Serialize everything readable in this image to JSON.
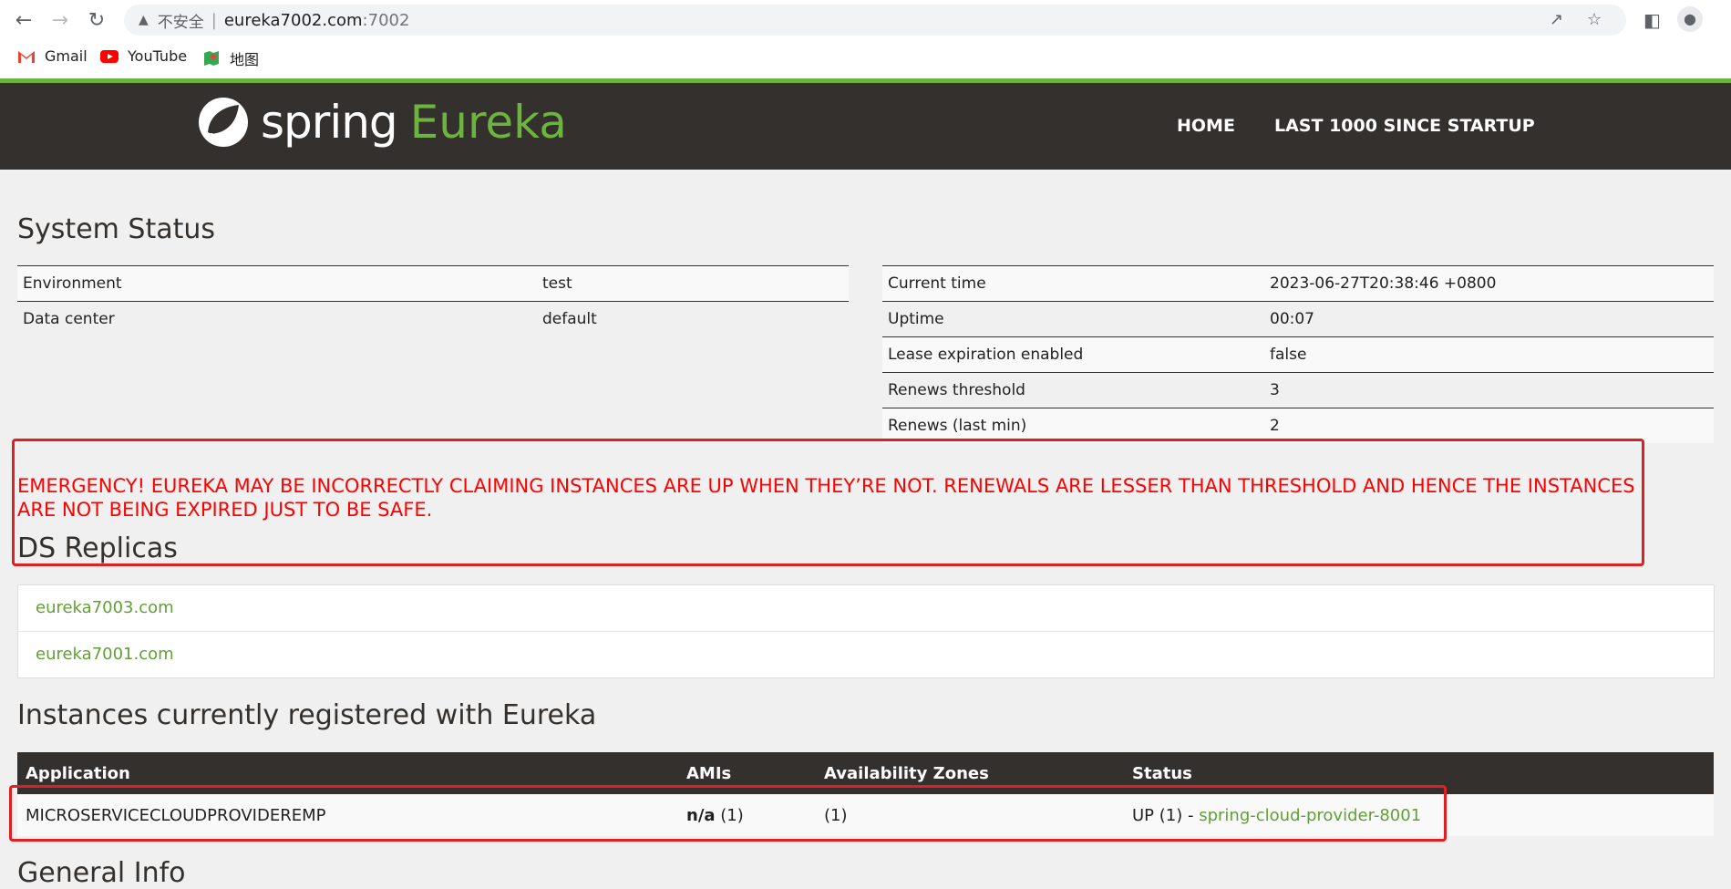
{
  "browser": {
    "insecure_label": "不安全",
    "host": "eureka7002.com",
    "port": ":7002",
    "bookmarks": [
      {
        "label": "Gmail"
      },
      {
        "label": "YouTube"
      },
      {
        "label": "地图"
      }
    ]
  },
  "header": {
    "logo_spring": "spring",
    "logo_eureka": "Eureka",
    "nav": {
      "home": "HOME",
      "last1000": "LAST 1000 SINCE STARTUP"
    }
  },
  "system_status": {
    "title": "System Status",
    "left": [
      {
        "k": "Environment",
        "v": "test"
      },
      {
        "k": "Data center",
        "v": "default"
      }
    ],
    "right": [
      {
        "k": "Current time",
        "v": "2023-06-27T20:38:46 +0800"
      },
      {
        "k": "Uptime",
        "v": "00:07"
      },
      {
        "k": "Lease expiration enabled",
        "v": "false"
      },
      {
        "k": "Renews threshold",
        "v": "3"
      },
      {
        "k": "Renews (last min)",
        "v": "2"
      }
    ]
  },
  "emergency": "EMERGENCY! EUREKA MAY BE INCORRECTLY CLAIMING INSTANCES ARE UP WHEN THEY’RE NOT. RENEWALS ARE LESSER THAN THRESHOLD AND HENCE THE INSTANCES ARE NOT BEING EXPIRED JUST TO BE SAFE.",
  "ds_replicas": {
    "title": "DS Replicas",
    "items": [
      "eureka7003.com",
      "eureka7001.com"
    ]
  },
  "instances": {
    "title": "Instances currently registered with Eureka",
    "headers": [
      "Application",
      "AMIs",
      "Availability Zones",
      "Status"
    ],
    "row": {
      "application": "MICROSERVICECLOUDPROVIDEREMP",
      "amis_bold": "n/a",
      "amis_count": "(1)",
      "zones": "(1)",
      "status_bold": "UP",
      "status_count": "(1) -",
      "status_link": "spring-cloud-provider-8001"
    }
  },
  "general_info": {
    "title": "General Info"
  },
  "colors": {
    "brand_green": "#6db33f",
    "header_dark": "#34302d",
    "alert_red": "#ff0000"
  }
}
